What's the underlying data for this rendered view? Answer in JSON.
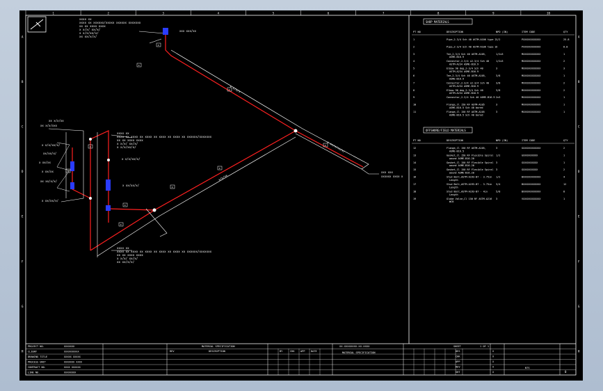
{
  "view": {
    "background": "#000000",
    "frame_color": "#b9c6d6",
    "line_color": "#ffffff",
    "pipe_color": "#ff2020",
    "weld_color": "#2a3cff"
  },
  "border": {
    "top_zones": [
      "1",
      "2",
      "3",
      "4",
      "5",
      "6",
      "7",
      "8",
      "9",
      "10"
    ],
    "side_zones": [
      "A",
      "B",
      "C",
      "D",
      "E",
      "F",
      "G",
      "H"
    ]
  },
  "shop_parts": {
    "title": "SHOP MATERIALS",
    "headers": [
      "PT NO",
      "DESCRIPTION",
      "NPD (IN)",
      "ITEM CODE",
      "QTY"
    ],
    "rows": [
      {
        "pt": "1",
        "desc": "Pipe,2-3/4 Sch 40 ASTM-A106 type 2",
        "npd": "1/2",
        "code": "PXXXXXXXXXXXX",
        "qty": "25.8"
      },
      {
        "pt": "2",
        "desc": "Pipe,2-3/4 Sch 40 ASTM-A106 type 2",
        "npd": "3",
        "code": "PXXXXXXXXXXXX",
        "qty": "8.8"
      },
      {
        "pt": "3",
        "desc": "Tee,2-3/4 Sch 40 ASTM-A105, ASME-B16.9",
        "npd": "1/2x3",
        "code": "MXXXXXXXXXXXX",
        "qty": "1"
      },
      {
        "pt": "4",
        "desc": "Connector,2-3/4 x2-3/4 Sch 40 ASTM-A234 ASME-B16.9",
        "npd": "1/2x3",
        "code": "MXXXXXXXXXXXX",
        "qty": "2"
      },
      {
        "pt": "5",
        "desc": "Elbow 90 deg,2-3/4 Sch 40 ASTM-A234 ASME-B16.9",
        "npd": "3",
        "code": "MXXXXXXXXXXXX",
        "qty": "3"
      },
      {
        "pt": "6",
        "desc": "Tee,2-3/4 Sch 40 ASTM-A105, ASME-B16.9",
        "npd": "3/8",
        "code": "MXXXXXXXXXXXX",
        "qty": "1"
      },
      {
        "pt": "7",
        "desc": "Connector,2-3/4 x2-3/4 Sch 40 ASTM-A234 ASME-B16.9",
        "npd": "3/8",
        "code": "MXXXXXXXXXXXX",
        "qty": "2"
      },
      {
        "pt": "8",
        "desc": "Elbow 90 deg,2-3/4 Sch 40 ASTM-A234 ASME-B16.9",
        "npd": "3/8",
        "code": "MXXXXXXXXXXXX",
        "qty": "2"
      },
      {
        "pt": "9",
        "desc": "Connector,2-3/4 Sch 40 ASME-B16.9",
        "npd": "2x3",
        "code": "MXXXXXXXXXXXX",
        "qty": "1"
      },
      {
        "pt": "10",
        "desc": "Flange,Cl 150 RF ASTM-A105 ASME-B16.5 Sch 40 bored",
        "npd": "3",
        "code": "MXXXXXXXXXXXX",
        "qty": "1"
      },
      {
        "pt": "11",
        "desc": "Flange,Cl 150 RF ASTM-A105 ASME-B16.5 Sch 40 bored",
        "npd": "3",
        "code": "MXXXXXXXXXXXX",
        "qty": "1"
      }
    ]
  },
  "field_parts": {
    "title": "OFFSHORE/FIELD MATERIALS",
    "headers": [
      "PT NO",
      "DESCRIPTION",
      "NPD (IN)",
      "ITEM CODE",
      "QTY"
    ],
    "rows": [
      {
        "pt": "12",
        "desc": "Flange,Cl 150 RF ASTM-A105, ASME-B16.5",
        "npd": "3",
        "code": "GXXXXXXXXXXXX",
        "qty": "2"
      },
      {
        "pt": "13",
        "desc": "Gasket,Cl 150 RF Flexible Spiral wound ASME-B16.20",
        "npd": "1/2",
        "code": "GXXXXXXXXXX",
        "qty": "1"
      },
      {
        "pt": "14",
        "desc": "Gasket,Cl 150 RF Flexible Spiral wound ASME-B16.20",
        "npd": "3",
        "code": "GXXXXXXXXXX",
        "qty": "1"
      },
      {
        "pt": "15",
        "desc": "Gasket,Cl 150 RF Flexible Spiral wound ASME-B16.20",
        "npd": "3",
        "code": "GXXXXXXXXXX",
        "qty": "2"
      },
      {
        "pt": "16",
        "desc": "Stud Bolt,ASTM-A193-B7 - 3.75in Length",
        "npd": "1/2",
        "code": "BXXXXXXXXXXXX",
        "qty": "4"
      },
      {
        "pt": "17",
        "desc": "Stud Bolt,ASTM-A193-B7 - 3.75in Length",
        "npd": "3/4",
        "code": "BXXXXXXXXXXXX",
        "qty": "12"
      },
      {
        "pt": "18",
        "desc": "Stud Bolt,ASTM-A193-B7 - 4in Length",
        "npd": "5/8",
        "code": "BXXXXXXXXXXXX",
        "qty": "8"
      },
      {
        "pt": "19",
        "desc": "Globe Valve,Cl 150 RF ASTM-A216 WCB",
        "npd": "3",
        "code": "VXXXXXXXXXXXX",
        "qty": "1"
      }
    ]
  },
  "drawing_labels": {
    "note_top": [
      "xxxx xx",
      "xxxx xx xxxxxx/xxxxx xxxxxx xxxxxxx",
      "xx xx xxxx xxxx",
      "x x/x/ xx/x/",
      "x x/x/xx/x/",
      "xx xx/x/x/"
    ],
    "tag_top": "xxx xxx/xx",
    "tag_right": "xxx xxx",
    "tag_right_sub": "xxxxxx xxxx x",
    "note_mid": [
      "xxxx xx",
      "xxxx xx xxxx xx xxxx xx xxxx xx xxxx xx xxxxxx/xxxxxxx",
      "xx xx xxxx xxxx",
      "x x/x/ xx/x/",
      "x x/x/xx/x/"
    ],
    "note_bottom": [
      "xxxx xx",
      "xxxx xx xxxx xx xxxx xx xxxx xx xxxx xx xxxxxx/xxxxxxx",
      "xx xx xxxx xxxx",
      "x x/x/ xx/x/",
      "xx xx/x/x/"
    ],
    "left_tags": [
      "xx x/x/xx",
      "xx x/x/xxx",
      "x x/x/xx/x/",
      "xx/xx/x/",
      "x xx/xx",
      "x xx/xx",
      "xx xx/x/x/",
      "x xx/xx/x/"
    ],
    "dims": [
      "x x/x/x",
      "x/x/xx",
      "x xx/x/xx/x/",
      "x x/x/xx/x/",
      "x xx/xx/x/"
    ],
    "small_tags": [
      "x",
      "x",
      "x",
      "x",
      "x",
      "x",
      "x",
      "x",
      "x",
      "x"
    ]
  },
  "title_block": {
    "left_rows": [
      "PROJECT NO.",
      "CLIENT",
      "DRAWING TITLE",
      "PROCESS UNIT",
      "CONTRACT NO.",
      "LINE NO."
    ],
    "left_values": [
      "XXXXXXX",
      "XXXXXXXXXX",
      "XXXXX XXXXX",
      "XXXXXXX XXXX",
      "XXXX XXXXXX",
      "XXXXXXXX"
    ],
    "headers": [
      "REV",
      "DESCRIPTION",
      "BY",
      "CHK",
      "APP",
      "DATE"
    ],
    "spec_header": "MATERIAL SPECIFICATION",
    "drawing_no": "XX-XXXXXXXX-XX-XXXX",
    "sheet_label": "SHEET",
    "sheet_value": "1 OF 1",
    "right_rows": [
      "DES",
      "CHK",
      "APP",
      "REV",
      "SHT"
    ],
    "revision": "0",
    "scale": "NTS"
  }
}
